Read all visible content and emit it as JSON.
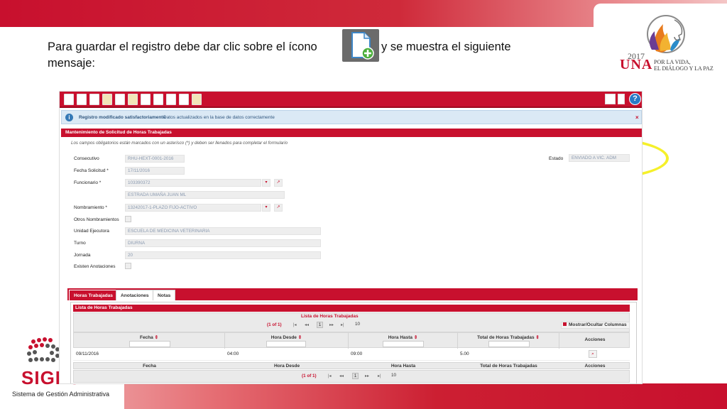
{
  "slide": {
    "instruction_line1": "Para guardar el registro debe dar clic sobre el ícono",
    "instruction_line1b": "y se muestra el siguiente",
    "instruction_line2": "mensaje:",
    "brand_red": "#c8102e"
  },
  "una_logo": {
    "year": "2017",
    "name": "UNA",
    "motto_line1": "POR LA VIDA,",
    "motto_line2": "EL DIÁLOGO Y LA PAZ"
  },
  "sigesa_logo": {
    "name": "SIGESA",
    "subtitle": "Sistema de Gestión Administrativa"
  },
  "toolbar": {
    "icons": [
      "new-doc-icon",
      "new-doc-icon",
      "doc-icon",
      "edit-doc-icon",
      "delete-doc-icon",
      "copy-doc-icon",
      "group-icon",
      "network-icon",
      "list-icon",
      "save-new-icon",
      "print-icon"
    ],
    "right_icons": [
      "table-icon",
      "attachment-icon",
      "help-icon"
    ],
    "help_label": "?"
  },
  "message": {
    "title": "Registro modificado satisfactoriamente",
    "text": "Datos actualizados en la base de datos correctamente",
    "close": "×",
    "info": "i"
  },
  "form": {
    "panel_title": "Mantenimiento de Solicitud de Horas Trabajadas",
    "required_note": "Los campos obligatorios están marcados con un asterisco (*) y deben ser llenados para completar el formulario",
    "consecutivo_label": "Consecutivo",
    "consecutivo_value": "RHU-HEXT-0001-2016",
    "fecha_label": "Fecha Solicitud *",
    "fecha_value": "17/11/2016",
    "funcionario_label": "Funcionario *",
    "funcionario_value": "103390372",
    "funcionario_name": "ESTRADA UMAÑA JUAN ML",
    "nombramiento_label": "Nombramiento *",
    "nombramiento_value": "13242017-1-PLAZO FIJO-ACTIVO",
    "otros_label": "Otros Nombramientos",
    "unidad_label": "Unidad Ejecutora",
    "unidad_value": "ESCUELA DE MEDICINA VETERINARIA",
    "turno_label": "Turno",
    "turno_value": "DIURNA",
    "jornada_label": "Jornada",
    "jornada_value": "20",
    "anotaciones_label": "Existen Anotaciones",
    "estado_label": "Estado",
    "estado_value": "ENVIADO A VIC. ADM",
    "dropdown_glyph": "▾",
    "link_glyph": "↗"
  },
  "tabs": [
    {
      "label": "Horas Trabajadas",
      "active": true
    },
    {
      "label": "Anotaciones",
      "active": false
    },
    {
      "label": "Notas",
      "active": false
    }
  ],
  "grid": {
    "title": "Lista de Horas Trabajadas",
    "caption": "Lista de Horas Trabajadas",
    "page_info": "(1 of 1)",
    "first": "|◂",
    "prev": "◂◂",
    "page": "1",
    "next": "▸▸",
    "last": "▸|",
    "rows_per_page": "10",
    "toggle_columns": "Mostrar/Ocultar Columnas",
    "sort_glyph": "⇕",
    "columns": [
      "Fecha",
      "Hora Desde",
      "Hora Hasta",
      "Total de Horas Trabajadas",
      "Acciones"
    ],
    "rows": [
      {
        "fecha": "09/11/2016",
        "desde": "04:00",
        "hasta": "09:00",
        "total": "5.00"
      }
    ],
    "action_glyph": "⌕"
  }
}
